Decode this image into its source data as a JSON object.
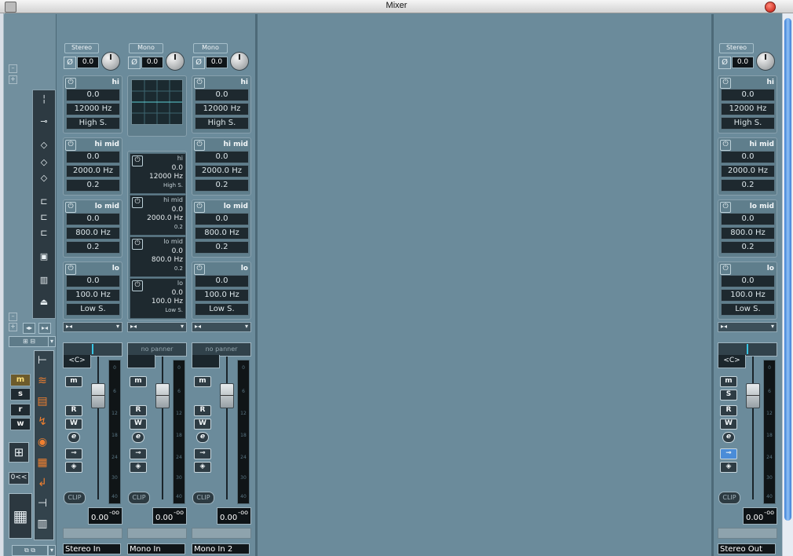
{
  "window": {
    "title": "Mixer"
  },
  "common": {
    "view_filters": [
      "m",
      "s",
      "r",
      "w"
    ],
    "zero_button": "0<<"
  },
  "channels": [
    {
      "name": "Stereo In",
      "type": "Stereo",
      "gain": "0.0",
      "bands": [
        {
          "name": "hi",
          "gain": "0.0",
          "freq": "12000 Hz",
          "q": "High S."
        },
        {
          "name": "hi mid",
          "gain": "0.0",
          "freq": "2000.0 Hz",
          "q": "0.2"
        },
        {
          "name": "lo mid",
          "gain": "0.0",
          "freq": "800.0 Hz",
          "q": "0.2"
        },
        {
          "name": "lo",
          "gain": "0.0",
          "freq": "100.0 Hz",
          "q": "Low S."
        }
      ],
      "panner": "<C>",
      "volume": "0.00",
      "peak": "-oo",
      "clip": "CLIP",
      "buttons": [
        "m",
        "R",
        "W",
        "e"
      ]
    },
    {
      "name": "Mono In",
      "type": "Mono",
      "gain": "0.0",
      "bands": [
        {
          "name": "hi",
          "gain": "0.0",
          "freq": "12000 Hz",
          "q": "High S."
        },
        {
          "name": "hi mid",
          "gain": "0.0",
          "freq": "2000.0 Hz",
          "q": "0.2"
        },
        {
          "name": "lo mid",
          "gain": "0.0",
          "freq": "800.0 Hz",
          "q": "0.2"
        },
        {
          "name": "lo",
          "gain": "0.0",
          "freq": "100.0 Hz",
          "q": "Low S."
        }
      ],
      "panner": "no panner",
      "volume": "0.00",
      "peak": "-oo",
      "clip": "CLIP",
      "buttons": [
        "m",
        "R",
        "W",
        "e"
      ]
    },
    {
      "name": "Mono In 2",
      "type": "Mono",
      "gain": "0.0",
      "bands": [
        {
          "name": "hi",
          "gain": "0.0",
          "freq": "12000 Hz",
          "q": "High S."
        },
        {
          "name": "hi mid",
          "gain": "0.0",
          "freq": "2000.0 Hz",
          "q": "0.2"
        },
        {
          "name": "lo mid",
          "gain": "0.0",
          "freq": "800.0 Hz",
          "q": "0.2"
        },
        {
          "name": "lo",
          "gain": "0.0",
          "freq": "100.0 Hz",
          "q": "Low S."
        }
      ],
      "panner": "no panner",
      "volume": "0.00",
      "peak": "-oo",
      "clip": "CLIP",
      "buttons": [
        "m",
        "R",
        "W",
        "e"
      ]
    },
    {
      "name": "Stereo Out",
      "type": "Stereo",
      "gain": "0.0",
      "bands": [
        {
          "name": "hi",
          "gain": "0.0",
          "freq": "12000 Hz",
          "q": "High S."
        },
        {
          "name": "hi mid",
          "gain": "0.0",
          "freq": "2000.0 Hz",
          "q": "0.2"
        },
        {
          "name": "lo mid",
          "gain": "0.0",
          "freq": "800.0 Hz",
          "q": "0.2"
        },
        {
          "name": "lo",
          "gain": "0.0",
          "freq": "100.0 Hz",
          "q": "Low S."
        }
      ],
      "panner": "<C>",
      "volume": "0.00",
      "peak": "-oo",
      "clip": "CLIP",
      "buttons": [
        "m",
        "S",
        "R",
        "W",
        "e"
      ]
    }
  ],
  "meter_scale": [
    "0",
    "6",
    "12",
    "18",
    "24",
    "30",
    "40"
  ]
}
